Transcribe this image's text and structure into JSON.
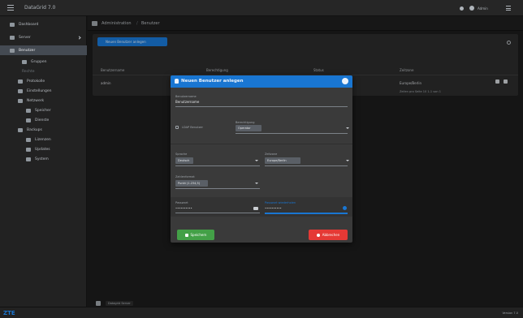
{
  "app": {
    "title": "DataGrid 7.0"
  },
  "topbar": {
    "user_label": "Admin"
  },
  "sidebar": {
    "items": [
      {
        "label": "Dashboard",
        "icon": "dashboard-icon"
      },
      {
        "label": "Server",
        "icon": "server-icon"
      },
      {
        "label": "Benutzer",
        "icon": "users-icon",
        "active": true
      },
      {
        "label": "Gruppen",
        "icon": "groups-icon"
      },
      {
        "label": "Rechte",
        "icon": "rights-icon"
      },
      {
        "label": "Protokolle",
        "icon": "log-icon"
      },
      {
        "label": "Einstellungen",
        "icon": "settings-icon"
      },
      {
        "label": "Netzwerk",
        "icon": "network-icon"
      },
      {
        "label": "Speicher",
        "icon": "storage-icon"
      },
      {
        "label": "Dienste",
        "icon": "services-icon"
      },
      {
        "label": "Backups",
        "icon": "backup-icon"
      },
      {
        "label": "Lizenzen",
        "icon": "license-icon"
      },
      {
        "label": "Updates",
        "icon": "update-icon"
      },
      {
        "label": "System",
        "icon": "system-icon"
      }
    ]
  },
  "breadcrumb": {
    "root": "Administration",
    "current": "Benutzer"
  },
  "panel": {
    "new_button": "Neuen Benutzer anlegen",
    "columns": [
      "Benutzername",
      "Berechtigung",
      "Status",
      "Zeitzone"
    ],
    "row": [
      "admin",
      "Administrator",
      "Aktiv",
      "Europe/Berlin"
    ],
    "pagination": "Zeilen pro Seite  10   1-1 von 1"
  },
  "dialog": {
    "title": "Neuen Benutzer anlegen",
    "username_label": "Benutzername",
    "username_value": "Benutzername",
    "ldap_label": "LDAP Benutzer",
    "permission_label": "Berechtigung",
    "permission_value": "Operator",
    "language_label": "Sprache",
    "language_value": "Deutsch",
    "timezone_label": "Zeitzone",
    "timezone_value": "Europe/Berlin",
    "format_label": "Zahlenformat",
    "format_value": "Punkt (1.234,5)",
    "password_label": "Passwort",
    "password_value": "••••••••••",
    "password2_label": "Passwort wiederholen",
    "password2_value": "••••••••••",
    "save_label": "Speichern",
    "cancel_label": "Abbrechen"
  },
  "footer": {
    "left": "Datagrid Server",
    "right": "Version 7.0"
  },
  "colors": {
    "accent": "#1976d2",
    "success": "#43a047",
    "danger": "#e53935"
  }
}
